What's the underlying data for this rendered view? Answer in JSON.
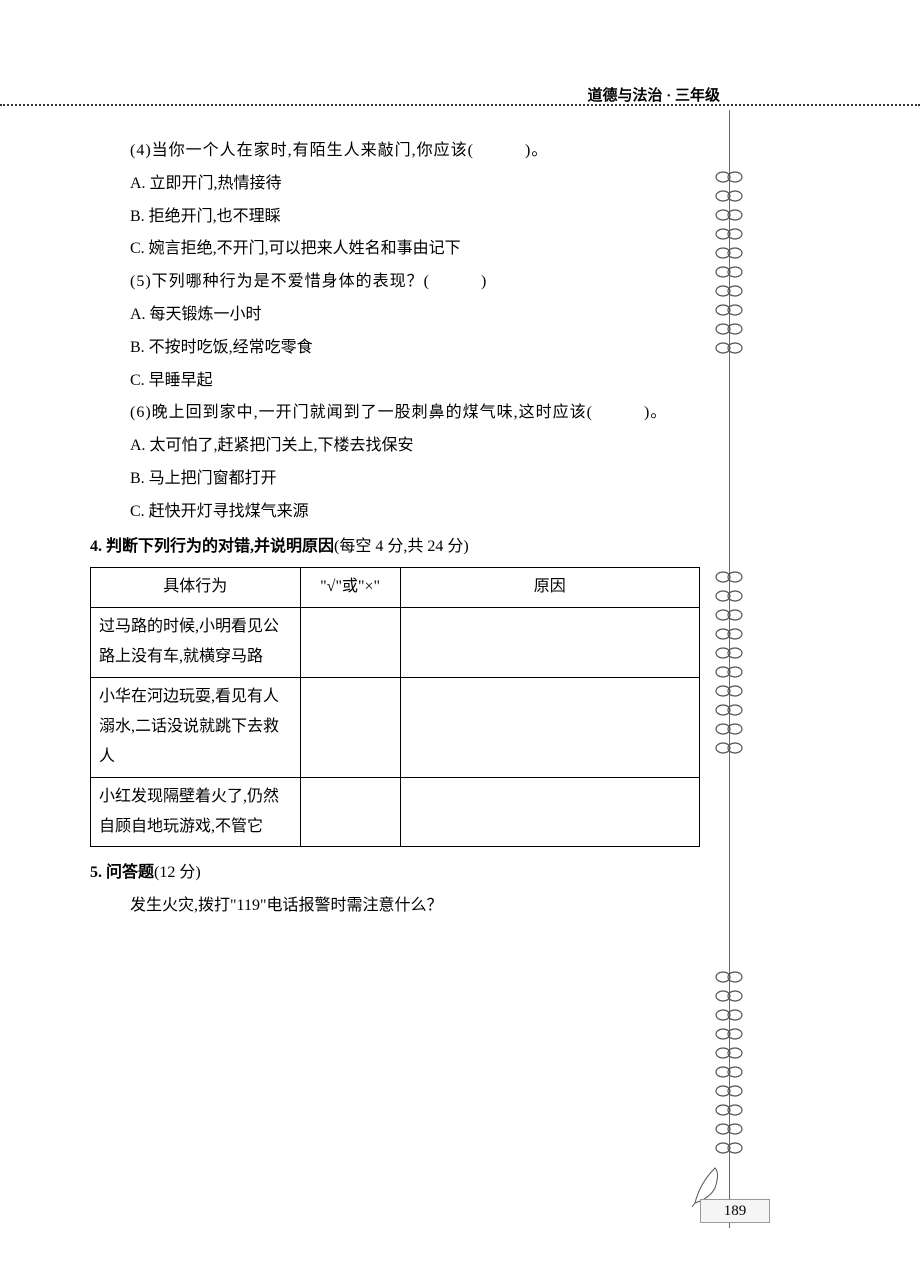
{
  "header": {
    "title": "道德与法治 · 三年级"
  },
  "q4": {
    "stem": "(4)当你一个人在家时,有陌生人来敲门,你应该(　　　)。",
    "a": "A. 立即开门,热情接待",
    "b": "B. 拒绝开门,也不理睬",
    "c": "C. 婉言拒绝,不开门,可以把来人姓名和事由记下"
  },
  "q5": {
    "stem": "(5)下列哪种行为是不爱惜身体的表现？(　　　)",
    "a": "A. 每天锻炼一小时",
    "b": "B. 不按时吃饭,经常吃零食",
    "c": "C. 早睡早起"
  },
  "q6": {
    "stem": "(6)晚上回到家中,一开门就闻到了一股刺鼻的煤气味,这时应该(　　　)。",
    "a": "A. 太可怕了,赶紧把门关上,下楼去找保安",
    "b": "B. 马上把门窗都打开",
    "c": "C. 赶快开灯寻找煤气来源"
  },
  "section4": {
    "title": "4. 判断下列行为的对错,并说明原因",
    "points": "(每空 4 分,共 24 分)",
    "headers": {
      "col1": "具体行为",
      "col2": "\"√\"或\"×\"",
      "col3": "原因"
    },
    "rows": [
      {
        "behavior": "过马路的时候,小明看见公路上没有车,就横穿马路",
        "mark": "",
        "reason": ""
      },
      {
        "behavior": "小华在河边玩耍,看见有人溺水,二话没说就跳下去救人",
        "mark": "",
        "reason": ""
      },
      {
        "behavior": "小红发现隔壁着火了,仍然自顾自地玩游戏,不管它",
        "mark": "",
        "reason": ""
      }
    ]
  },
  "section5": {
    "title": "5. 问答题",
    "points": "(12 分)",
    "question": "发生火灾,拨打\"119\"电话报警时需注意什么？"
  },
  "page_number": "189"
}
